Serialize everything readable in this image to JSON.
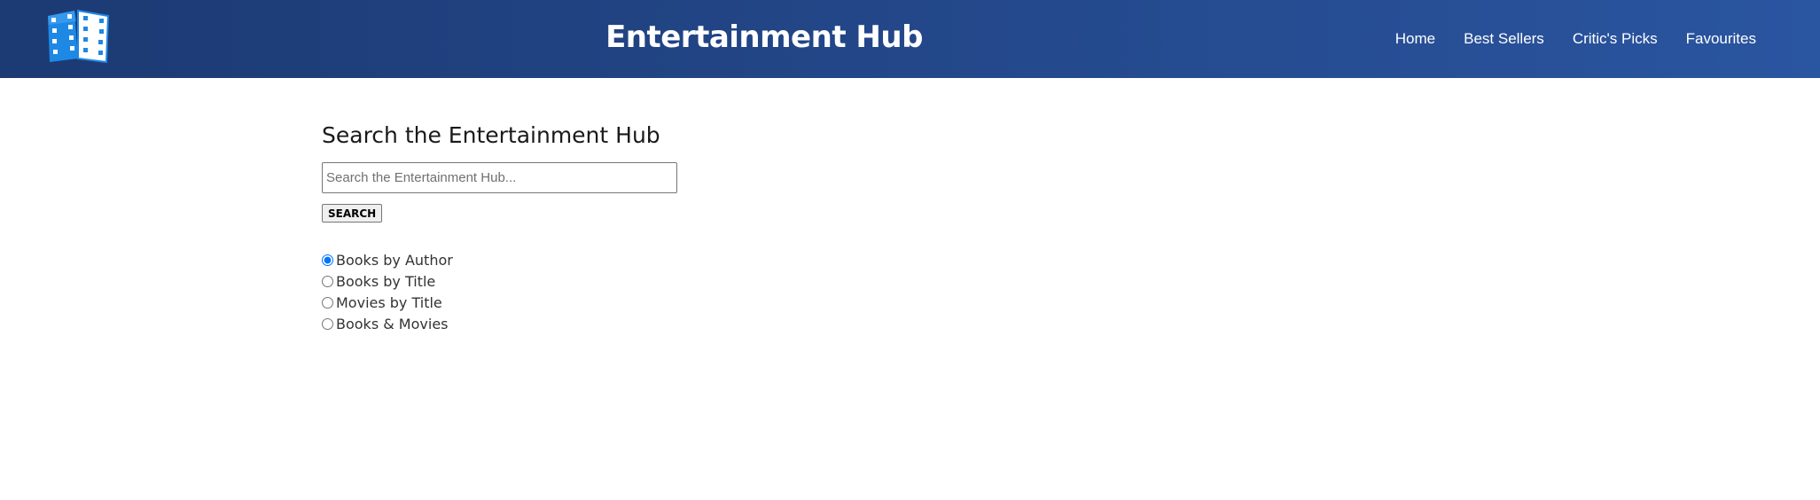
{
  "header": {
    "title": "Entertainment Hub",
    "nav": [
      {
        "label": "Home"
      },
      {
        "label": "Best Sellers"
      },
      {
        "label": "Critic's Picks"
      },
      {
        "label": "Favourites"
      }
    ],
    "logo_icon": "book-film-icon"
  },
  "search": {
    "heading": "Search the Entertainment Hub",
    "placeholder": "Search the Entertainment Hub...",
    "value": "",
    "button_label": "SEARCH"
  },
  "options": [
    {
      "label": "Books by Author",
      "checked": true
    },
    {
      "label": "Books by Title",
      "checked": false
    },
    {
      "label": "Movies by Title",
      "checked": false
    },
    {
      "label": "Books & Movies",
      "checked": false
    }
  ],
  "colors": {
    "header_start": "#1c3a73",
    "header_end": "#2a55a0",
    "logo_blue": "#1e88e5"
  }
}
